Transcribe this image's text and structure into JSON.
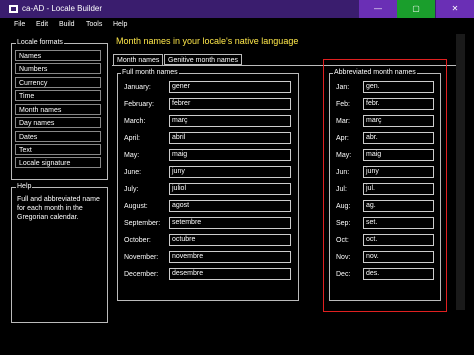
{
  "window": {
    "title": "ca-AD - Locale Builder",
    "minimize": "—",
    "maximize": "▢",
    "close": "✕"
  },
  "menu": [
    "File",
    "Edit",
    "Build",
    "Tools",
    "Help"
  ],
  "locale_formats": {
    "legend": "Locale formats",
    "items": [
      "Names",
      "Numbers",
      "Currency",
      "Time",
      "Month names",
      "Day names",
      "Dates",
      "Text",
      "Locale signature"
    ]
  },
  "help": {
    "legend": "Help",
    "text": "Full and abbreviated name for each month in the Gregorian calendar."
  },
  "page_title": "Month names in your locale's native language",
  "tabs": [
    "Month names",
    "Genitive month names"
  ],
  "full": {
    "legend": "Full month names",
    "labels": [
      "January:",
      "February:",
      "March:",
      "April:",
      "May:",
      "June:",
      "July:",
      "August:",
      "September:",
      "October:",
      "November:",
      "December:"
    ],
    "values": [
      "gener",
      "febrer",
      "març",
      "abril",
      "maig",
      "juny",
      "juliol",
      "agost",
      "setembre",
      "octubre",
      "novembre",
      "desembre"
    ]
  },
  "abbr": {
    "legend": "Abbreviated month names",
    "labels": [
      "Jan:",
      "Feb:",
      "Mar:",
      "Apr:",
      "May:",
      "Jun:",
      "Jul:",
      "Aug:",
      "Sep:",
      "Oct:",
      "Nov:",
      "Dec:"
    ],
    "values": [
      "gen.",
      "febr.",
      "març",
      "abr.",
      "maig",
      "juny",
      "jul.",
      "ag.",
      "set.",
      "oct.",
      "nov.",
      "des."
    ]
  }
}
